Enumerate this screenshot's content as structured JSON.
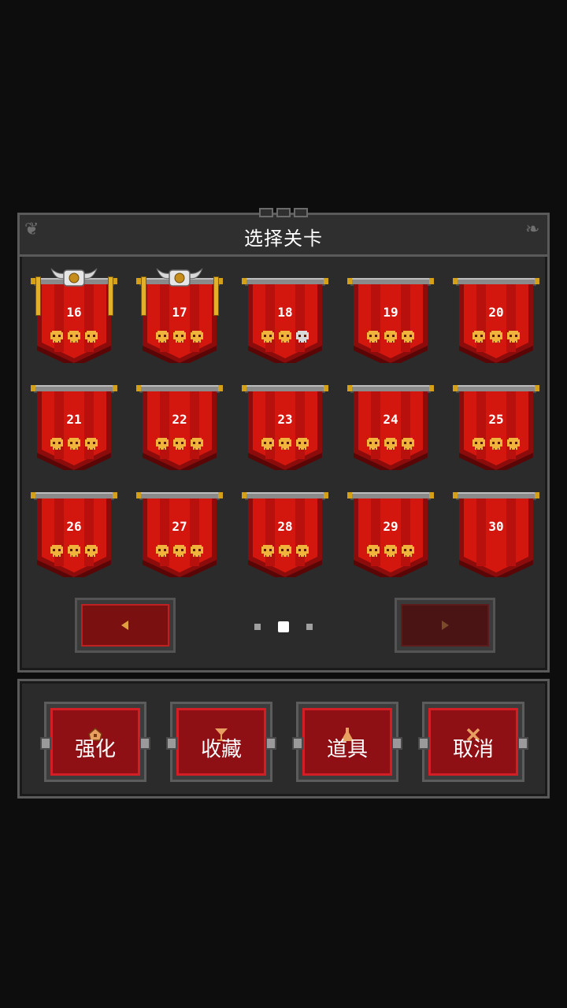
{
  "title": "选择关卡",
  "levels": [
    {
      "num": "16",
      "skulls": [
        "gold",
        "gold",
        "gold"
      ],
      "crest": true
    },
    {
      "num": "17",
      "skulls": [
        "gold",
        "gold",
        "gold"
      ],
      "crest": true
    },
    {
      "num": "18",
      "skulls": [
        "gold",
        "gold",
        "silver"
      ],
      "crest": false
    },
    {
      "num": "19",
      "skulls": [
        "gold",
        "gold",
        "gold"
      ],
      "crest": false
    },
    {
      "num": "20",
      "skulls": [
        "gold",
        "gold",
        "gold"
      ],
      "crest": false
    },
    {
      "num": "21",
      "skulls": [
        "gold",
        "gold",
        "gold"
      ],
      "crest": false
    },
    {
      "num": "22",
      "skulls": [
        "gold",
        "gold",
        "gold"
      ],
      "crest": false
    },
    {
      "num": "23",
      "skulls": [
        "gold",
        "gold",
        "gold"
      ],
      "crest": false
    },
    {
      "num": "24",
      "skulls": [
        "gold",
        "gold",
        "gold"
      ],
      "crest": false
    },
    {
      "num": "25",
      "skulls": [
        "gold",
        "gold",
        "gold"
      ],
      "crest": false
    },
    {
      "num": "26",
      "skulls": [
        "gold",
        "gold",
        "gold"
      ],
      "crest": false
    },
    {
      "num": "27",
      "skulls": [
        "gold",
        "gold",
        "gold"
      ],
      "crest": false
    },
    {
      "num": "28",
      "skulls": [
        "gold",
        "gold",
        "gold"
      ],
      "crest": false
    },
    {
      "num": "29",
      "skulls": [
        "gold",
        "gold",
        "gold"
      ],
      "crest": false
    },
    {
      "num": "30",
      "skulls": [],
      "crest": false
    }
  ],
  "pager": {
    "pages": 3,
    "current": 2
  },
  "nav": {
    "prev_icon": "triangle-left-icon",
    "next_icon": "triangle-right-icon"
  },
  "actions": [
    {
      "label": "强化",
      "icon": "upgrade-icon"
    },
    {
      "label": "收藏",
      "icon": "goblet-icon"
    },
    {
      "label": "道具",
      "icon": "potion-icon"
    },
    {
      "label": "取消",
      "icon": "close-icon"
    }
  ],
  "colors": {
    "banner_red": "#d3170f",
    "banner_dark": "#8c0c0c",
    "skull_gold": "#f0b43c",
    "skull_silver": "#d9d9d9",
    "accent": "#e1b12c"
  }
}
